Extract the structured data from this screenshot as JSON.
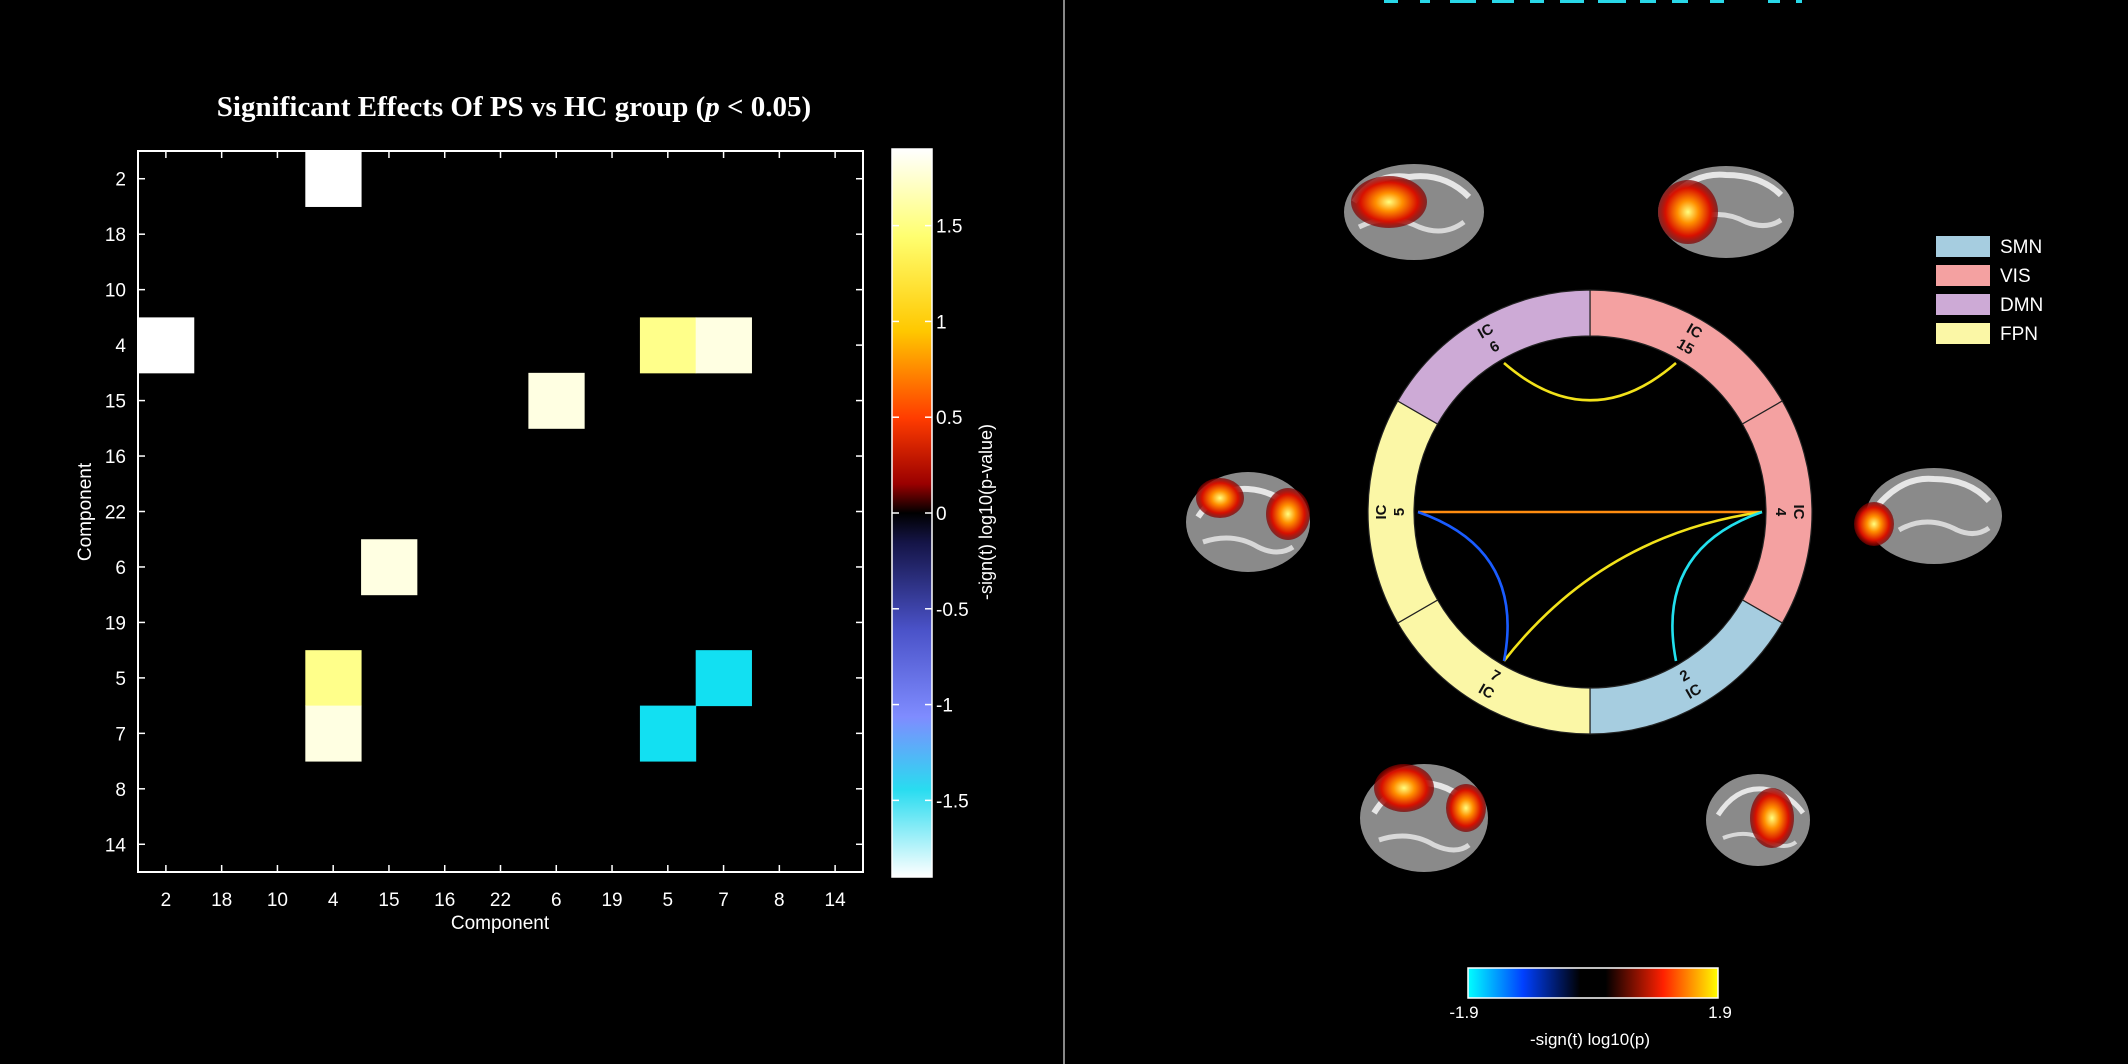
{
  "chart_data": [
    {
      "type": "heatmap",
      "title": "Significant Effects Of PS vs HC group (p < 0.05)",
      "title_parts": [
        "Significant Effects Of PS vs HC group (",
        "p",
        " < 0.05)"
      ],
      "xlabel": "Component",
      "ylabel": "Component",
      "rows": [
        "2",
        "18",
        "10",
        "4",
        "15",
        "16",
        "22",
        "6",
        "19",
        "5",
        "7",
        "8",
        "14"
      ],
      "cols": [
        "2",
        "18",
        "10",
        "4",
        "15",
        "16",
        "22",
        "6",
        "19",
        "5",
        "7",
        "8",
        "14"
      ],
      "cells": [
        {
          "row": "2",
          "col": "4",
          "value": 1.9
        },
        {
          "row": "4",
          "col": "2",
          "value": 1.9
        },
        {
          "row": "4",
          "col": "5",
          "value": 1.5
        },
        {
          "row": "4",
          "col": "7",
          "value": 1.8
        },
        {
          "row": "15",
          "col": "6",
          "value": 1.8
        },
        {
          "row": "6",
          "col": "15",
          "value": 1.8
        },
        {
          "row": "5",
          "col": "4",
          "value": 1.5
        },
        {
          "row": "5",
          "col": "7",
          "value": -1.5
        },
        {
          "row": "7",
          "col": "4",
          "value": 1.8
        },
        {
          "row": "7",
          "col": "5",
          "value": -1.5
        }
      ],
      "colorbar": {
        "label": "-sign(t) log10(p-value)",
        "range": [
          -1.9,
          1.9
        ],
        "ticks": [
          1.5,
          1,
          0.5,
          0,
          -0.5,
          -1,
          -1.5
        ],
        "tick_labels": [
          "1.5",
          "1",
          "0.5",
          "0",
          "-0.5",
          "-1",
          "-1.5"
        ]
      }
    },
    {
      "type": "connectogram",
      "segments": [
        {
          "network": "VIS",
          "label": "IC",
          "id": "15",
          "angle_start": 0,
          "angle_end": 60
        },
        {
          "network": "VIS",
          "label": "IC",
          "id": "4",
          "angle_start": 60,
          "angle_end": 120
        },
        {
          "network": "SMN",
          "label": "IC",
          "id": "2",
          "angle_start": 120,
          "angle_end": 180
        },
        {
          "network": "FPN",
          "label": "IC",
          "id": "7",
          "angle_start": 180,
          "angle_end": 240
        },
        {
          "network": "FPN",
          "label": "IC",
          "id": "5",
          "angle_start": 240,
          "angle_end": 300
        },
        {
          "network": "DMN",
          "label": "IC",
          "id": "6",
          "angle_start": 300,
          "angle_end": 360
        }
      ],
      "links": [
        {
          "from": "6",
          "to": "15",
          "value": 1.8
        },
        {
          "from": "5",
          "to": "4",
          "value": 1.5
        },
        {
          "from": "7",
          "to": "4",
          "value": 1.8
        },
        {
          "from": "5",
          "to": "7",
          "value": -1.5
        },
        {
          "from": "2",
          "to": "4",
          "value": -1.5
        }
      ],
      "legend": [
        {
          "name": "SMN",
          "color": "#a6cde0"
        },
        {
          "name": "VIS",
          "color": "#f4a1a1"
        },
        {
          "name": "DMN",
          "color": "#cdaad6"
        },
        {
          "name": "FPN",
          "color": "#fbf7a6"
        }
      ],
      "legend_position": "top-right",
      "colorbar": {
        "label": "-sign(t) log10(p)",
        "min_label": "-1.9",
        "max_label": "1.9"
      }
    }
  ]
}
